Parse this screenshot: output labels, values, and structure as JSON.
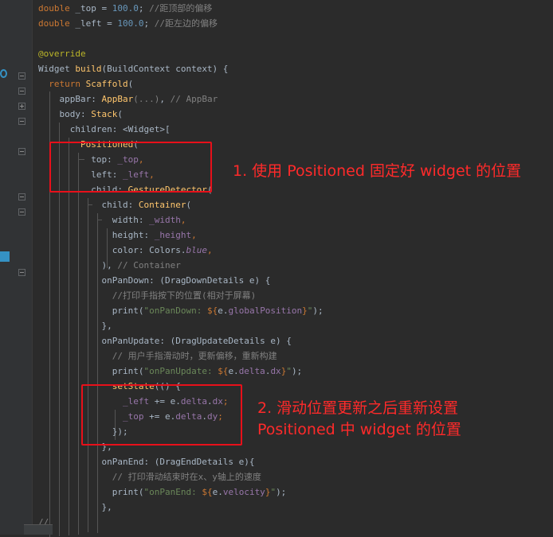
{
  "code_lines": [
    {
      "id": "l0",
      "parts": [
        {
          "t": "double ",
          "c": "kw"
        },
        {
          "t": "_top",
          "c": ""
        },
        {
          "t": " = ",
          "c": ""
        },
        {
          "t": "100.0",
          "c": "num"
        },
        {
          "t": "; ",
          "c": ""
        },
        {
          "t": "//距顶部的偏移",
          "c": "cmt"
        }
      ]
    },
    {
      "id": "l1",
      "parts": [
        {
          "t": "double ",
          "c": "kw"
        },
        {
          "t": "_left",
          "c": ""
        },
        {
          "t": " = ",
          "c": ""
        },
        {
          "t": "100.0",
          "c": "num"
        },
        {
          "t": "; ",
          "c": ""
        },
        {
          "t": "//距左边的偏移",
          "c": "cmt"
        }
      ]
    },
    {
      "id": "l2",
      "parts": [
        {
          "t": "@override",
          "c": "ann"
        }
      ]
    },
    {
      "id": "l3",
      "parts": [
        {
          "t": "Widget ",
          "c": ""
        },
        {
          "t": "build",
          "c": "fn"
        },
        {
          "t": "(BuildContext context) {",
          "c": ""
        }
      ]
    },
    {
      "id": "l4",
      "parts": [
        {
          "t": "  return ",
          "c": "kw"
        },
        {
          "t": "Scaffold",
          "c": "fn"
        },
        {
          "t": "(",
          "c": ""
        }
      ]
    },
    {
      "id": "l5",
      "parts": [
        {
          "t": "    appBar",
          "c": ""
        },
        {
          "t": ": ",
          "c": ""
        },
        {
          "t": "AppBar",
          "c": "fn"
        },
        {
          "t": "(...)",
          "c": "cmt"
        },
        {
          "t": ", ",
          "c": ""
        },
        {
          "t": "// AppBar",
          "c": "cmt"
        }
      ]
    },
    {
      "id": "l6",
      "parts": [
        {
          "t": "    body",
          "c": ""
        },
        {
          "t": ": ",
          "c": ""
        },
        {
          "t": "Stack",
          "c": "fn"
        },
        {
          "t": "(",
          "c": ""
        }
      ]
    },
    {
      "id": "l7",
      "parts": [
        {
          "t": "      children",
          "c": ""
        },
        {
          "t": ": <Widget>[",
          "c": ""
        }
      ]
    },
    {
      "id": "l8",
      "parts": [
        {
          "t": "        Positioned",
          "c": "fn"
        },
        {
          "t": "(",
          "c": ""
        }
      ]
    },
    {
      "id": "l9",
      "parts": [
        {
          "t": "          top",
          "c": ""
        },
        {
          "t": ": ",
          "c": ""
        },
        {
          "t": "_top",
          "c": "fld"
        },
        {
          "t": ",",
          "c": "kw"
        }
      ]
    },
    {
      "id": "l10",
      "parts": [
        {
          "t": "          left",
          "c": ""
        },
        {
          "t": ": ",
          "c": ""
        },
        {
          "t": "_left",
          "c": "fld"
        },
        {
          "t": ",",
          "c": "kw"
        }
      ]
    },
    {
      "id": "l11",
      "parts": [
        {
          "t": "          child",
          "c": ""
        },
        {
          "t": ": ",
          "c": ""
        },
        {
          "t": "GestureDetector",
          "c": "fn"
        },
        {
          "t": "(",
          "c": ""
        }
      ]
    },
    {
      "id": "l12",
      "parts": [
        {
          "t": "            child",
          "c": ""
        },
        {
          "t": ": ",
          "c": ""
        },
        {
          "t": "Container",
          "c": "fn"
        },
        {
          "t": "(",
          "c": ""
        }
      ]
    },
    {
      "id": "l13",
      "parts": [
        {
          "t": "              width",
          "c": ""
        },
        {
          "t": ": ",
          "c": ""
        },
        {
          "t": "_width",
          "c": "fld"
        },
        {
          "t": ",",
          "c": "kw"
        }
      ]
    },
    {
      "id": "l14",
      "parts": [
        {
          "t": "              height",
          "c": ""
        },
        {
          "t": ": ",
          "c": ""
        },
        {
          "t": "_height",
          "c": "fld"
        },
        {
          "t": ",",
          "c": "kw"
        }
      ]
    },
    {
      "id": "l15",
      "parts": [
        {
          "t": "              color",
          "c": ""
        },
        {
          "t": ": Colors.",
          "c": ""
        },
        {
          "t": "blue",
          "c": "fld-it"
        },
        {
          "t": ",",
          "c": "kw"
        }
      ]
    },
    {
      "id": "l16",
      "parts": [
        {
          "t": "            ), ",
          "c": ""
        },
        {
          "t": "// Container",
          "c": "cmt"
        }
      ]
    },
    {
      "id": "l17",
      "parts": [
        {
          "t": "            onPanDown",
          "c": ""
        },
        {
          "t": ": (DragDownDetails e) {",
          "c": ""
        }
      ]
    },
    {
      "id": "l18",
      "parts": [
        {
          "t": "              //打印手指按下的位置(相对于屏幕)",
          "c": "cmt"
        }
      ]
    },
    {
      "id": "l19",
      "parts": [
        {
          "t": "              print",
          "c": ""
        },
        {
          "t": "(",
          "c": ""
        },
        {
          "t": "\"onPanDown: ",
          "c": "str"
        },
        {
          "t": "${",
          "c": "kw"
        },
        {
          "t": "e.",
          "c": ""
        },
        {
          "t": "globalPosition",
          "c": "fld"
        },
        {
          "t": "}",
          "c": "kw"
        },
        {
          "t": "\"",
          "c": "str"
        },
        {
          "t": ");",
          "c": ""
        }
      ]
    },
    {
      "id": "l20",
      "parts": [
        {
          "t": "            },",
          "c": ""
        }
      ]
    },
    {
      "id": "l21",
      "parts": [
        {
          "t": "            onPanUpdate",
          "c": ""
        },
        {
          "t": ": (DragUpdateDetails e) {",
          "c": ""
        }
      ]
    },
    {
      "id": "l22",
      "parts": [
        {
          "t": "              // 用户手指滑动时，更新偏移，重新构建",
          "c": "cmt"
        }
      ]
    },
    {
      "id": "l23",
      "parts": [
        {
          "t": "              print",
          "c": ""
        },
        {
          "t": "(",
          "c": ""
        },
        {
          "t": "\"onPanUpdate: ",
          "c": "str"
        },
        {
          "t": "${",
          "c": "kw"
        },
        {
          "t": "e.",
          "c": ""
        },
        {
          "t": "delta",
          "c": "fld"
        },
        {
          "t": ".",
          "c": ""
        },
        {
          "t": "dx",
          "c": "fld"
        },
        {
          "t": "}",
          "c": "kw"
        },
        {
          "t": "\"",
          "c": "str"
        },
        {
          "t": ");",
          "c": ""
        }
      ]
    },
    {
      "id": "l24",
      "parts": [
        {
          "t": "              setState",
          "c": "fn"
        },
        {
          "t": "(() {",
          "c": ""
        }
      ]
    },
    {
      "id": "l25",
      "parts": [
        {
          "t": "                _left",
          "c": "fld"
        },
        {
          "t": " += e.",
          "c": ""
        },
        {
          "t": "delta",
          "c": "fld"
        },
        {
          "t": ".",
          "c": ""
        },
        {
          "t": "dx",
          "c": "fld"
        },
        {
          "t": ";",
          "c": "kw"
        }
      ]
    },
    {
      "id": "l26",
      "parts": [
        {
          "t": "                _top",
          "c": "fld"
        },
        {
          "t": " += e.",
          "c": ""
        },
        {
          "t": "delta",
          "c": "fld"
        },
        {
          "t": ".",
          "c": ""
        },
        {
          "t": "dy",
          "c": "fld"
        },
        {
          "t": ";",
          "c": "kw"
        }
      ]
    },
    {
      "id": "l27",
      "parts": [
        {
          "t": "              });",
          "c": ""
        }
      ]
    },
    {
      "id": "l28",
      "parts": [
        {
          "t": "            },",
          "c": ""
        }
      ]
    },
    {
      "id": "l29",
      "parts": [
        {
          "t": "            onPanEnd",
          "c": ""
        },
        {
          "t": ": (DragEndDetails e){",
          "c": ""
        }
      ]
    },
    {
      "id": "l30",
      "parts": [
        {
          "t": "              // 打印滑动结束时在x、y轴上的速度",
          "c": "cmt"
        }
      ]
    },
    {
      "id": "l31",
      "parts": [
        {
          "t": "              print",
          "c": ""
        },
        {
          "t": "(",
          "c": ""
        },
        {
          "t": "\"onPanEnd: ",
          "c": "str"
        },
        {
          "t": "${",
          "c": "kw"
        },
        {
          "t": "e.",
          "c": ""
        },
        {
          "t": "velocity",
          "c": "fld"
        },
        {
          "t": "}",
          "c": "kw"
        },
        {
          "t": "\"",
          "c": "str"
        },
        {
          "t": ");",
          "c": ""
        }
      ]
    },
    {
      "id": "l32",
      "parts": [
        {
          "t": "            },",
          "c": ""
        }
      ]
    },
    {
      "id": "l33",
      "parts": [
        {
          "t": "//",
          "c": "cmt"
        }
      ]
    }
  ],
  "annotations": {
    "note1": "1. 使用 Positioned 固定好 widget 的位置",
    "note2_line1": "2. 滑动位置更新之后重新设置",
    "note2_line2": "Positioned 中 widget 的位置"
  },
  "colors": {
    "background": "#2b2b2b",
    "gutter": "#313335",
    "highlight_box": "#e8101a",
    "annotation_text": "#ff2a2a"
  }
}
